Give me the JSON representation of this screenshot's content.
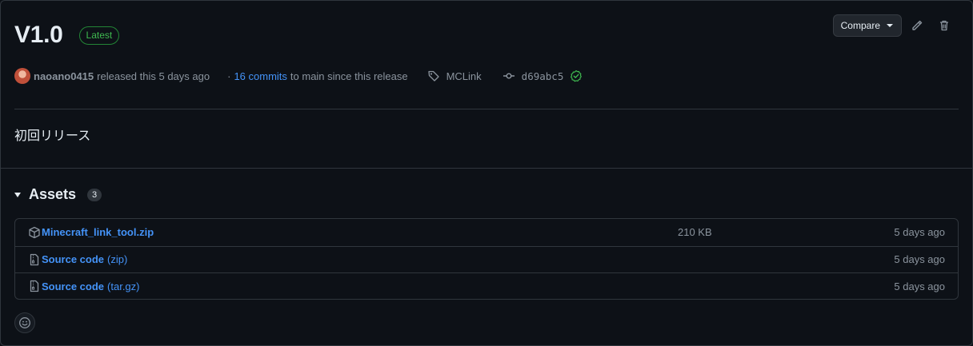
{
  "release": {
    "title": "V1.0",
    "latest_label": "Latest",
    "compare_label": "Compare",
    "author": "naoano0415",
    "released_text": "released this 5 days ago",
    "commits_prefix": "·",
    "commits_link": "16 commits",
    "commits_suffix": "to main since this release",
    "tag": "MCLink",
    "commit_sha": "d69abc5",
    "body": "初回リリース"
  },
  "assets": {
    "title": "Assets",
    "count": "3",
    "items": [
      {
        "name": "Minecraft_link_tool.zip",
        "suffix": "",
        "size": "210 KB",
        "date": "5 days ago",
        "icon": "package-icon"
      },
      {
        "name": "Source code",
        "suffix": "(zip)",
        "size": "",
        "date": "5 days ago",
        "icon": "file-zip-icon"
      },
      {
        "name": "Source code",
        "suffix": "(tar.gz)",
        "size": "",
        "date": "5 days ago",
        "icon": "file-zip-icon"
      }
    ]
  },
  "colors": {
    "background": "#0d1117",
    "border": "#30363d",
    "link": "#4493f8",
    "muted": "#8b949e",
    "success": "#3fb950"
  }
}
